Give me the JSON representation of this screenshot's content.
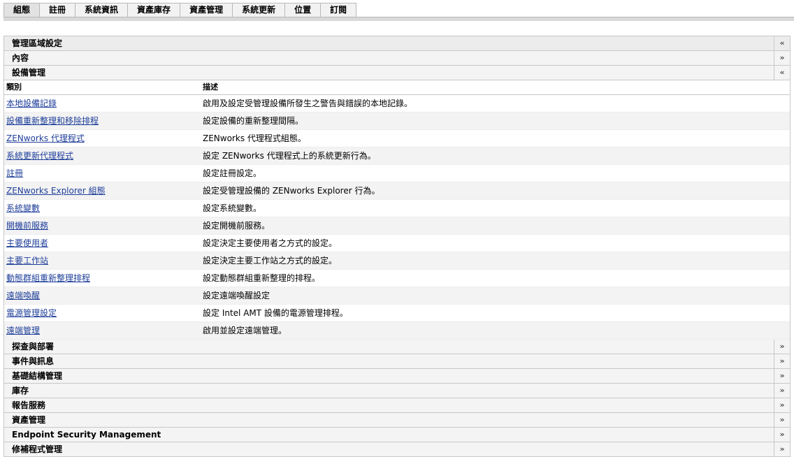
{
  "tabs": [
    "組態",
    "註冊",
    "系統資訊",
    "資產庫存",
    "資產管理",
    "系統更新",
    "位置",
    "訂閱"
  ],
  "sections_top": [
    {
      "title": "管理區域設定",
      "chevron": "«"
    },
    {
      "title": "內容",
      "chevron": "»"
    },
    {
      "title": "設備管理",
      "chevron": "«"
    }
  ],
  "columns": {
    "category": "類別",
    "description": "描述"
  },
  "rows": [
    {
      "label": "本地設備記錄",
      "desc": "啟用及設定受管理設備所發生之警告與錯誤的本地記錄。"
    },
    {
      "label": "設備重新整理和移除排程",
      "desc": "設定設備的重新整理間隔。"
    },
    {
      "label": "ZENworks 代理程式",
      "desc": "ZENworks 代理程式組態。"
    },
    {
      "label": "系統更新代理程式",
      "desc": "設定 ZENworks 代理程式上的系統更新行為。"
    },
    {
      "label": "註冊",
      "desc": "設定註冊設定。"
    },
    {
      "label": "ZENworks Explorer 組態",
      "desc": "設定受管理設備的 ZENworks Explorer 行為。"
    },
    {
      "label": "系統變數",
      "desc": "設定系統變數。"
    },
    {
      "label": "開機前服務",
      "desc": "設定開機前服務。"
    },
    {
      "label": "主要使用者",
      "desc": "設定決定主要使用者之方式的設定。"
    },
    {
      "label": "主要工作站",
      "desc": "設定決定主要工作站之方式的設定。"
    },
    {
      "label": "動態群組重新整理排程",
      "desc": "設定動態群組重新整理的排程。"
    },
    {
      "label": "遠端喚醒",
      "desc": "設定遠端喚醒設定"
    },
    {
      "label": "電源管理設定",
      "desc": "設定 Intel AMT 設備的電源管理排程。"
    },
    {
      "label": "遠端管理",
      "desc": "啟用並設定遠端管理。"
    }
  ],
  "sections_bottom": [
    {
      "title": "探查與部署",
      "chevron": "»"
    },
    {
      "title": "事件與訊息",
      "chevron": "»"
    },
    {
      "title": "基礎結構管理",
      "chevron": "»"
    },
    {
      "title": "庫存",
      "chevron": "»"
    },
    {
      "title": "報告服務",
      "chevron": "»"
    },
    {
      "title": "資產管理",
      "chevron": "»"
    },
    {
      "title": "Endpoint Security Management",
      "chevron": "»"
    },
    {
      "title": "修補程式管理",
      "chevron": "»"
    }
  ]
}
